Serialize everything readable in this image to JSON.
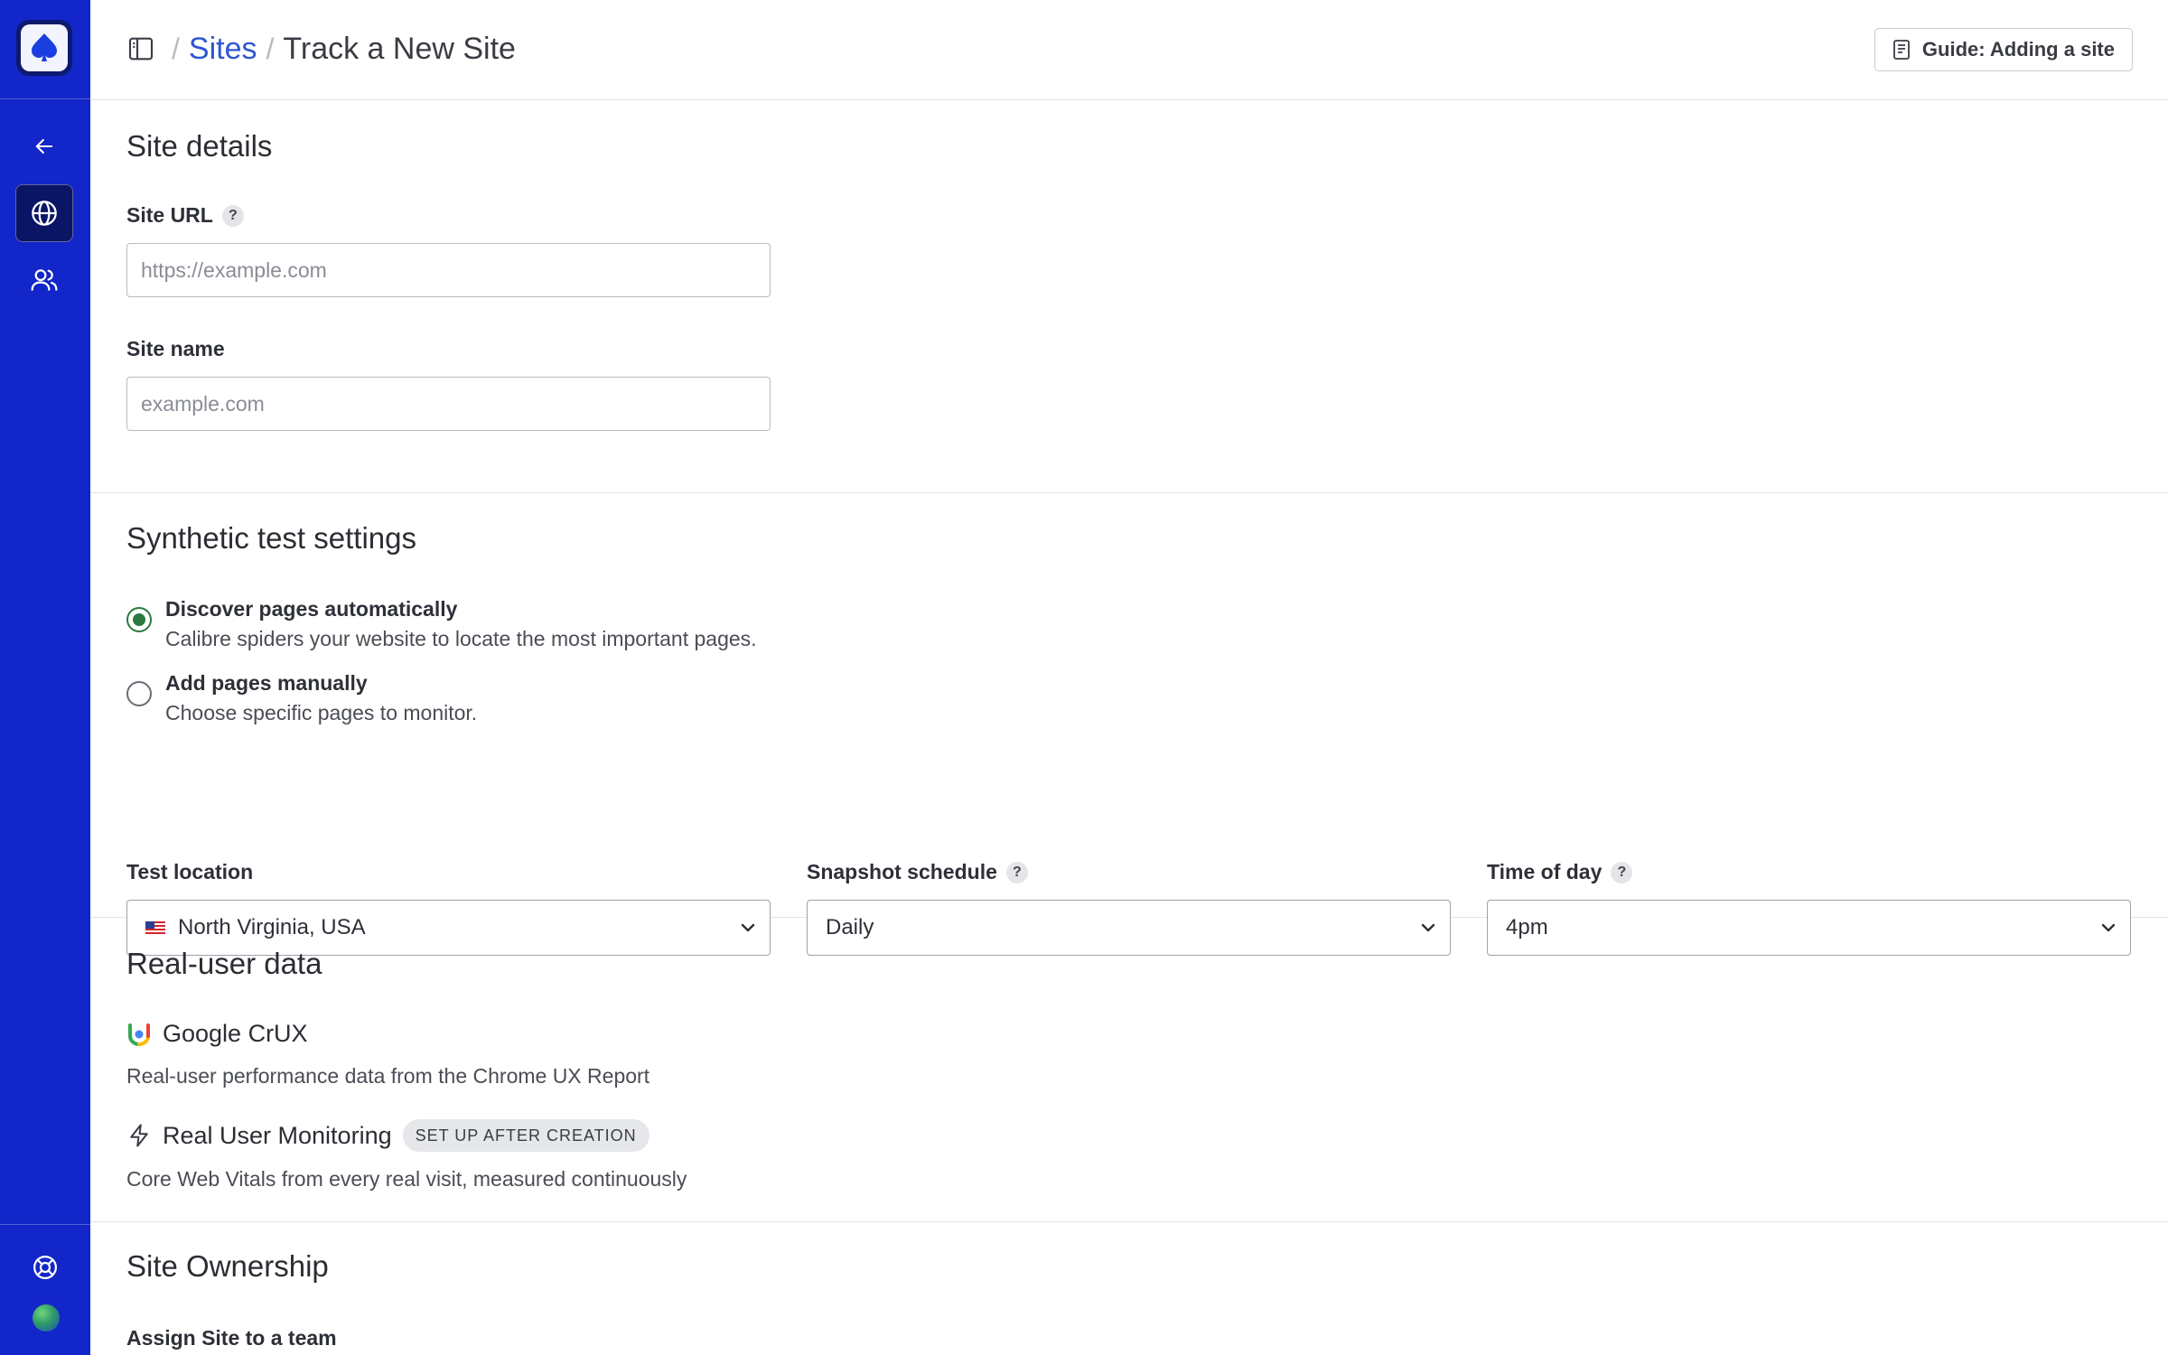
{
  "header": {
    "breadcrumb_sep": "/",
    "breadcrumb_link": "Sites",
    "page_title": "Track a New Site",
    "guide_button": "Guide: Adding a site"
  },
  "sections": {
    "site_details": {
      "heading": "Site details",
      "url_label": "Site URL",
      "url_placeholder": "https://example.com",
      "name_label": "Site name",
      "name_placeholder": "example.com"
    },
    "synthetic": {
      "heading": "Synthetic test settings",
      "options": [
        {
          "title": "Discover pages automatically",
          "desc": "Calibre spiders your website to locate the most important pages.",
          "checked": true
        },
        {
          "title": "Add pages manually",
          "desc": "Choose specific pages to monitor.",
          "checked": false
        }
      ],
      "location_label": "Test location",
      "location_value": "North Virginia, USA",
      "schedule_label": "Snapshot schedule",
      "schedule_value": "Daily",
      "time_label": "Time of day",
      "time_value": "4pm"
    },
    "real_user": {
      "heading": "Real-user data",
      "crux_title": "Google CrUX",
      "crux_desc": "Real-user performance data from the Chrome UX Report",
      "rum_title": "Real User Monitoring",
      "rum_badge": "SET UP AFTER CREATION",
      "rum_desc": "Core Web Vitals from every real visit, measured continuously"
    },
    "ownership": {
      "heading": "Site Ownership",
      "team_label": "Assign Site to a team"
    }
  },
  "help_badge": "?",
  "colors": {
    "sidebar": "#1226c9",
    "link": "#2f55d4",
    "radio_checked": "#2a7a3f"
  },
  "icons": [
    "spade-logo-icon",
    "arrow-left-icon",
    "globe-icon",
    "users-icon",
    "lifebuoy-icon",
    "sidebar-toggle-icon",
    "book-icon",
    "chevron-down-icon",
    "crux-icon",
    "lightning-icon",
    "us-flag-icon"
  ]
}
